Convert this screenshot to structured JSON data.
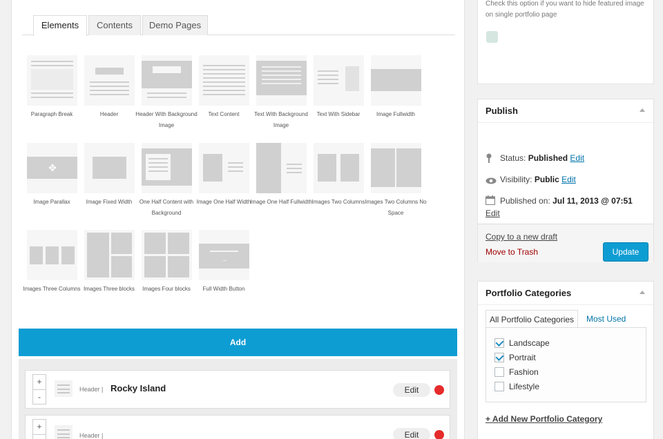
{
  "tabs": [
    "Elements",
    "Contents",
    "Demo Pages"
  ],
  "elements": [
    {
      "label": "Paragraph Break",
      "icon": "paragraph-break-icon"
    },
    {
      "label": "Header",
      "icon": "header-icon"
    },
    {
      "label": "Header With Background Image",
      "icon": "header-bg-icon"
    },
    {
      "label": "Text Content",
      "icon": "text-content-icon"
    },
    {
      "label": "Text With Background Image",
      "icon": "text-bg-icon"
    },
    {
      "label": "Text With Sidebar",
      "icon": "text-sidebar-icon"
    },
    {
      "label": "Image Fullwidth",
      "icon": "image-fullwidth-icon"
    },
    {
      "label": "Image Parallax",
      "icon": "image-parallax-icon"
    },
    {
      "label": "Image Fixed Width",
      "icon": "image-fixed-width-icon"
    },
    {
      "label": "One Half Content with Background",
      "icon": "one-half-content-icon"
    },
    {
      "label": "Image One Half Width",
      "icon": "image-one-half-icon"
    },
    {
      "label": "Image One Half Fullwidth",
      "icon": "image-one-half-fullwidth-icon"
    },
    {
      "label": "Images Two Columns",
      "icon": "images-two-columns-icon"
    },
    {
      "label": "Images Two Columns No Space",
      "icon": "images-two-columns-nospace-icon"
    },
    {
      "label": "Images Three Columns",
      "icon": "images-three-columns-icon"
    },
    {
      "label": "Images Three blocks",
      "icon": "images-three-blocks-icon"
    },
    {
      "label": "Images Four blocks",
      "icon": "images-four-blocks-icon"
    },
    {
      "label": "Full Width Button",
      "icon": "full-width-button-icon"
    }
  ],
  "add_label": "Add",
  "rows": [
    {
      "type": "Header |",
      "title": "Rocky Island",
      "edit": "Edit",
      "plus": "+",
      "minus": "-"
    },
    {
      "type": "Header |",
      "title": "",
      "edit": "Edit",
      "plus": "+",
      "minus": "-"
    }
  ],
  "featured_box": {
    "text": "Check this option if you want to hide featured image on single portfolio page"
  },
  "publish": {
    "title": "Publish",
    "status_label": "Status:",
    "status_value": "Published",
    "status_edit": "Edit",
    "visibility_label": "Visibility:",
    "visibility_value": "Public",
    "visibility_edit": "Edit",
    "published_label": "Published on:",
    "published_value": "Jul 11, 2013 @ 07:51",
    "published_edit": "Edit",
    "copy_draft": "Copy to a new draft",
    "trash": "Move to Trash",
    "update": "Update"
  },
  "categories": {
    "title": "Portfolio Categories",
    "tab_all": "All Portfolio Categories",
    "tab_used": "Most Used",
    "items": [
      {
        "label": "Landscape",
        "checked": true
      },
      {
        "label": "Portrait",
        "checked": true
      },
      {
        "label": "Fashion",
        "checked": false
      },
      {
        "label": "Lifestyle",
        "checked": false
      }
    ],
    "add_new": "+ Add New Portfolio Category"
  },
  "colors": {
    "accent": "#0e9dd3",
    "link": "#0073aa",
    "delete_dot": "#e52b2b",
    "trash": "#a00000"
  }
}
